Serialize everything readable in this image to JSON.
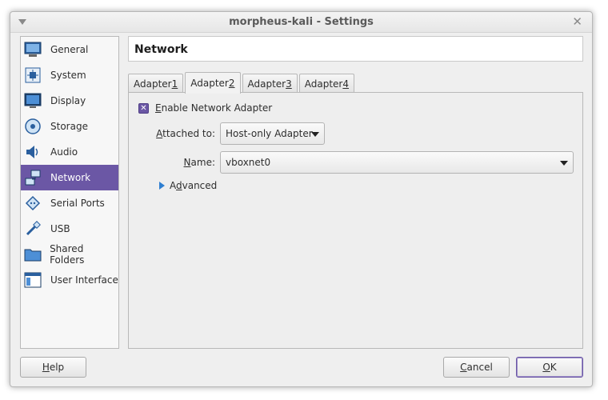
{
  "window": {
    "title": "morpheus-kali - Settings"
  },
  "sidebar": {
    "items": [
      {
        "label": "General",
        "icon": "monitor-icon"
      },
      {
        "label": "System",
        "icon": "chip-icon"
      },
      {
        "label": "Display",
        "icon": "display-icon"
      },
      {
        "label": "Storage",
        "icon": "disk-icon"
      },
      {
        "label": "Audio",
        "icon": "speaker-icon"
      },
      {
        "label": "Network",
        "icon": "network-icon",
        "selected": true
      },
      {
        "label": "Serial Ports",
        "icon": "serial-port-icon"
      },
      {
        "label": "USB",
        "icon": "usb-icon"
      },
      {
        "label": "Shared Folders",
        "icon": "folder-icon"
      },
      {
        "label": "User Interface",
        "icon": "window-icon"
      }
    ]
  },
  "page": {
    "title": "Network"
  },
  "tabs": [
    {
      "label": "Adapter ",
      "mnemonic": "1"
    },
    {
      "label": "Adapter ",
      "mnemonic": "2",
      "active": true
    },
    {
      "label": "Adapter ",
      "mnemonic": "3"
    },
    {
      "label": "Adapter ",
      "mnemonic": "4"
    }
  ],
  "adapter": {
    "enable_label_mnemonic": "E",
    "enable_label_rest": "nable Network Adapter",
    "enabled": true,
    "attached_label_mnemonic": "A",
    "attached_label_rest": "ttached to:",
    "attached_value": "Host-only Adapter",
    "name_label_mnemonic": "N",
    "name_label_rest": "ame:",
    "name_value": "vboxnet0",
    "advanced_label_pre": "A",
    "advanced_label_mnemonic": "d",
    "advanced_label_rest": "vanced"
  },
  "buttons": {
    "help_mnemonic": "H",
    "help_rest": "elp",
    "cancel_mnemonic": "C",
    "cancel_rest": "ancel",
    "ok_mnemonic": "O",
    "ok_rest": "K"
  },
  "colors": {
    "accent": "#6b57a5",
    "expander": "#2f7fd1"
  }
}
